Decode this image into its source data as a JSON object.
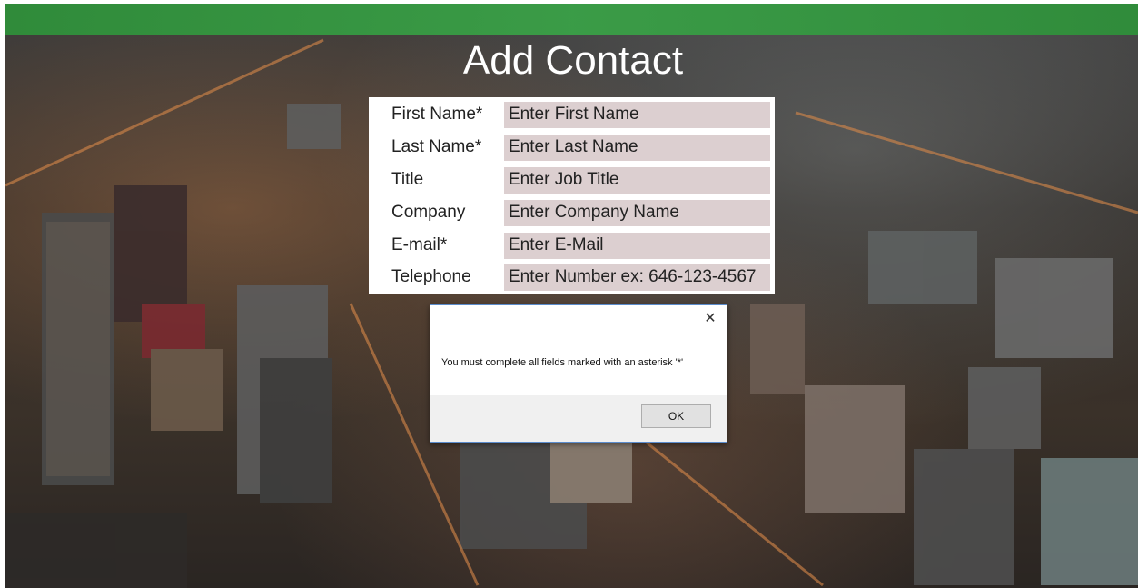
{
  "page": {
    "title": "Add Contact"
  },
  "form": {
    "fields": [
      {
        "label": "First Name*",
        "placeholder": "Enter First Name"
      },
      {
        "label": "Last Name*",
        "placeholder": "Enter Last Name"
      },
      {
        "label": "Title",
        "placeholder": "Enter Job Title"
      },
      {
        "label": "Company",
        "placeholder": "Enter Company Name"
      },
      {
        "label": "E-mail*",
        "placeholder": "Enter E-Mail"
      },
      {
        "label": "Telephone",
        "placeholder": "Enter Number ex: 646-123-4567"
      }
    ]
  },
  "dialog": {
    "message": "You must complete all fields marked with an asterisk '*'",
    "ok_label": "OK",
    "close_icon": "close-icon"
  },
  "colors": {
    "top_bar": "#3aa047",
    "input_bg": "#dccfd0",
    "dialog_border": "#5b8ccc"
  }
}
